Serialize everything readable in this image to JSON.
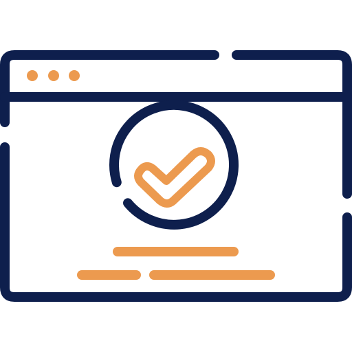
{
  "icon": {
    "name": "browser-window-approved-icon",
    "colors": {
      "outline": "#0E1F4D",
      "accent": "#EC9A4F",
      "background": "#FFFFFF"
    },
    "window_control_dots": 3,
    "text_lines": 2
  }
}
